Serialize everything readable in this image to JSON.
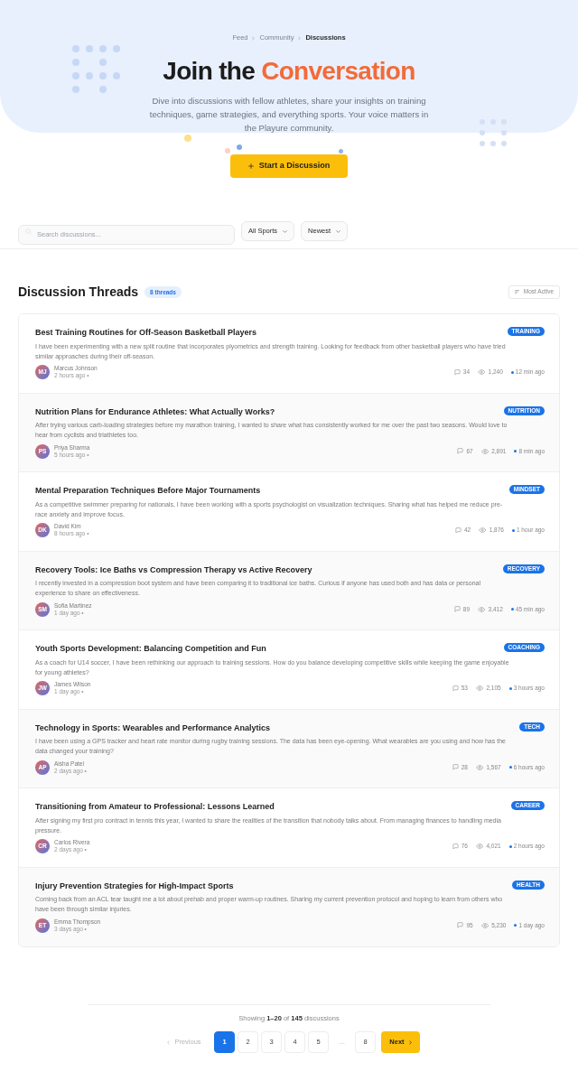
{
  "breadcrumb": [
    {
      "label": "Feed",
      "current": false
    },
    {
      "label": "Community",
      "current": false
    },
    {
      "label": "Discussions",
      "current": true
    }
  ],
  "hero": {
    "title": "Join the",
    "title_highlight": "Conversation",
    "description": "Dive into discussions with fellow athletes, share your insights on training techniques, game strategies, and everything sports. Your voice matters in the Playure community.",
    "button": "Start a Discussion"
  },
  "filters": {
    "search_placeholder": "Search discussions...",
    "dropdowns": [
      "All Sports",
      "Newest"
    ]
  },
  "threads_header": {
    "title": "Discussion Threads",
    "count": "8 threads",
    "sort": "Most Active"
  },
  "threads": [
    {
      "title": "Best Training Routines for Off-Season Basketball Players",
      "excerpt": "I have been experimenting with a new split routine that incorporates plyometrics and strength training. Looking for feedback from other basketball players who have tried similar approaches during their off-season.",
      "tag": "TRAINING",
      "initials": "MJ",
      "author": "Marcus Johnson",
      "posted": "2 hours ago •",
      "comments": "34",
      "views": "1,240",
      "activity": "12 min ago"
    },
    {
      "title": "Nutrition Plans for Endurance Athletes: What Actually Works?",
      "excerpt": "After trying various carb-loading strategies before my marathon training, I wanted to share what has consistently worked for me over the past two seasons. Would love to hear from cyclists and triathletes too.",
      "tag": "NUTRITION",
      "initials": "PS",
      "author": "Priya Sharma",
      "posted": "5 hours ago •",
      "comments": "67",
      "views": "2,891",
      "activity": "8 min ago"
    },
    {
      "title": "Mental Preparation Techniques Before Major Tournaments",
      "excerpt": "As a competitive swimmer preparing for nationals, I have been working with a sports psychologist on visualization techniques. Sharing what has helped me reduce pre-race anxiety and improve focus.",
      "tag": "MINDSET",
      "initials": "DK",
      "author": "David Kim",
      "posted": "8 hours ago •",
      "comments": "42",
      "views": "1,876",
      "activity": "1 hour ago"
    },
    {
      "title": "Recovery Tools: Ice Baths vs Compression Therapy vs Active Recovery",
      "excerpt": "I recently invested in a compression boot system and have been comparing it to traditional ice baths. Curious if anyone has used both and has data or personal experience to share on effectiveness.",
      "tag": "RECOVERY",
      "initials": "SM",
      "author": "Sofia Martinez",
      "posted": "1 day ago •",
      "comments": "89",
      "views": "3,412",
      "activity": "45 min ago"
    },
    {
      "title": "Youth Sports Development: Balancing Competition and Fun",
      "excerpt": "As a coach for U14 soccer, I have been rethinking our approach to training sessions. How do you balance developing competitive skills while keeping the game enjoyable for young athletes?",
      "tag": "COACHING",
      "initials": "JW",
      "author": "James Wilson",
      "posted": "1 day ago •",
      "comments": "53",
      "views": "2,105",
      "activity": "3 hours ago"
    },
    {
      "title": "Technology in Sports: Wearables and Performance Analytics",
      "excerpt": "I have been using a GPS tracker and heart rate monitor during rugby training sessions. The data has been eye-opening. What wearables are you using and how has the data changed your training?",
      "tag": "TECH",
      "initials": "AP",
      "author": "Aisha Patel",
      "posted": "2 days ago •",
      "comments": "28",
      "views": "1,567",
      "activity": "6 hours ago"
    },
    {
      "title": "Transitioning from Amateur to Professional: Lessons Learned",
      "excerpt": "After signing my first pro contract in tennis this year, I wanted to share the realities of the transition that nobody talks about. From managing finances to handling media pressure.",
      "tag": "CAREER",
      "initials": "CR",
      "author": "Carlos Rivera",
      "posted": "2 days ago •",
      "comments": "76",
      "views": "4,021",
      "activity": "2 hours ago"
    },
    {
      "title": "Injury Prevention Strategies for High-Impact Sports",
      "excerpt": "Coming back from an ACL tear taught me a lot about prehab and proper warm-up routines. Sharing my current prevention protocol and hoping to learn from others who have been through similar injuries.",
      "tag": "HEALTH",
      "initials": "ET",
      "author": "Emma Thompson",
      "posted": "3 days ago •",
      "comments": "95",
      "views": "5,230",
      "activity": "1 day ago"
    }
  ],
  "pagination": {
    "summary": "Showing **1–20** of **145** discussions",
    "previous": {
      "label": "Previous",
      "disabled": true
    },
    "pages": [
      {
        "label": "1",
        "kind": "page",
        "selected": true
      },
      {
        "label": "2",
        "kind": "page",
        "selected": false
      },
      {
        "label": "3",
        "kind": "page",
        "selected": false
      },
      {
        "label": "4",
        "kind": "page",
        "selected": false
      },
      {
        "label": "5",
        "kind": "page",
        "selected": false
      },
      {
        "label": "…",
        "kind": "gap",
        "selected": false
      },
      {
        "label": "8",
        "kind": "page",
        "selected": false
      }
    ],
    "next": "Next"
  }
}
